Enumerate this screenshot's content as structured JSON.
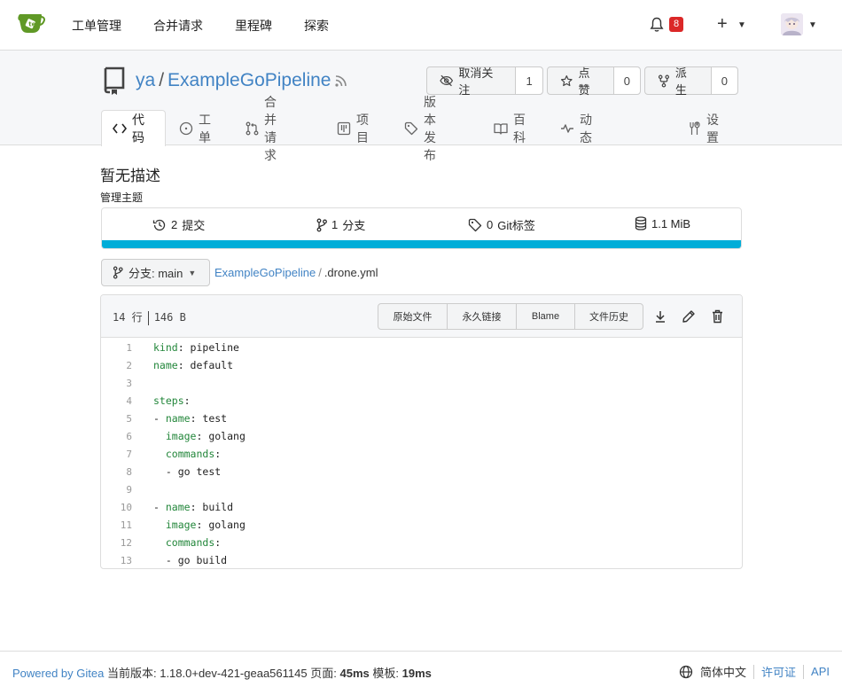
{
  "nav": {
    "items": [
      "工单管理",
      "合并请求",
      "里程碑",
      "探索"
    ],
    "notification_count": "8"
  },
  "repo": {
    "owner": "ya",
    "separator": "/",
    "name": "ExampleGoPipeline",
    "watch_label": "取消关注",
    "watch_count": "1",
    "star_label": "点赞",
    "star_count": "0",
    "fork_label": "派生",
    "fork_count": "0"
  },
  "tabs": [
    "代码",
    "工单",
    "合并请求",
    "项目",
    "版本发布",
    "百科",
    "动态",
    "设置"
  ],
  "summary": {
    "description": "暂无描述",
    "topics_label": "管理主题",
    "commits": "2",
    "commits_label": "提交",
    "branches": "1",
    "branches_label": "分支",
    "tags": "0",
    "tags_label": "Git标签",
    "size": "1.1 MiB",
    "lang_color": "#00add8"
  },
  "branch": {
    "label": "分支: main"
  },
  "breadcrumb": {
    "repo": "ExampleGoPipeline",
    "divider": "/",
    "file": ".drone.yml"
  },
  "file": {
    "lines_info": "14 行",
    "size_info": "146 B",
    "buttons": [
      "原始文件",
      "永久链接",
      "Blame",
      "文件历史"
    ],
    "code": [
      {
        "n": "1",
        "key": "kind",
        "rest": ": pipeline",
        "indent": ""
      },
      {
        "n": "2",
        "key": "name",
        "rest": ": default",
        "indent": ""
      },
      {
        "n": "3",
        "key": "",
        "rest": "",
        "indent": ""
      },
      {
        "n": "4",
        "key": "steps",
        "rest": ":",
        "indent": ""
      },
      {
        "n": "5",
        "key": "name",
        "rest": ": test",
        "indent": "- "
      },
      {
        "n": "6",
        "key": "image",
        "rest": ": golang",
        "indent": "  "
      },
      {
        "n": "7",
        "key": "commands",
        "rest": ":",
        "indent": "  "
      },
      {
        "n": "8",
        "key": "",
        "rest": "- go test",
        "indent": "  "
      },
      {
        "n": "9",
        "key": "",
        "rest": "",
        "indent": ""
      },
      {
        "n": "10",
        "key": "name",
        "rest": ": build",
        "indent": "- "
      },
      {
        "n": "11",
        "key": "image",
        "rest": ": golang",
        "indent": "  "
      },
      {
        "n": "12",
        "key": "commands",
        "rest": ":",
        "indent": "  "
      },
      {
        "n": "13",
        "key": "",
        "rest": "- go build",
        "indent": "  "
      }
    ]
  },
  "footer": {
    "powered": "Powered by Gitea",
    "version_label": "当前版本:",
    "version": "1.18.0+dev-421-geaa561145",
    "page_label": "页面:",
    "page_time": "45ms",
    "template_label": "模板:",
    "template_time": "19ms",
    "language": "简体中文",
    "license": "许可证",
    "api": "API"
  }
}
